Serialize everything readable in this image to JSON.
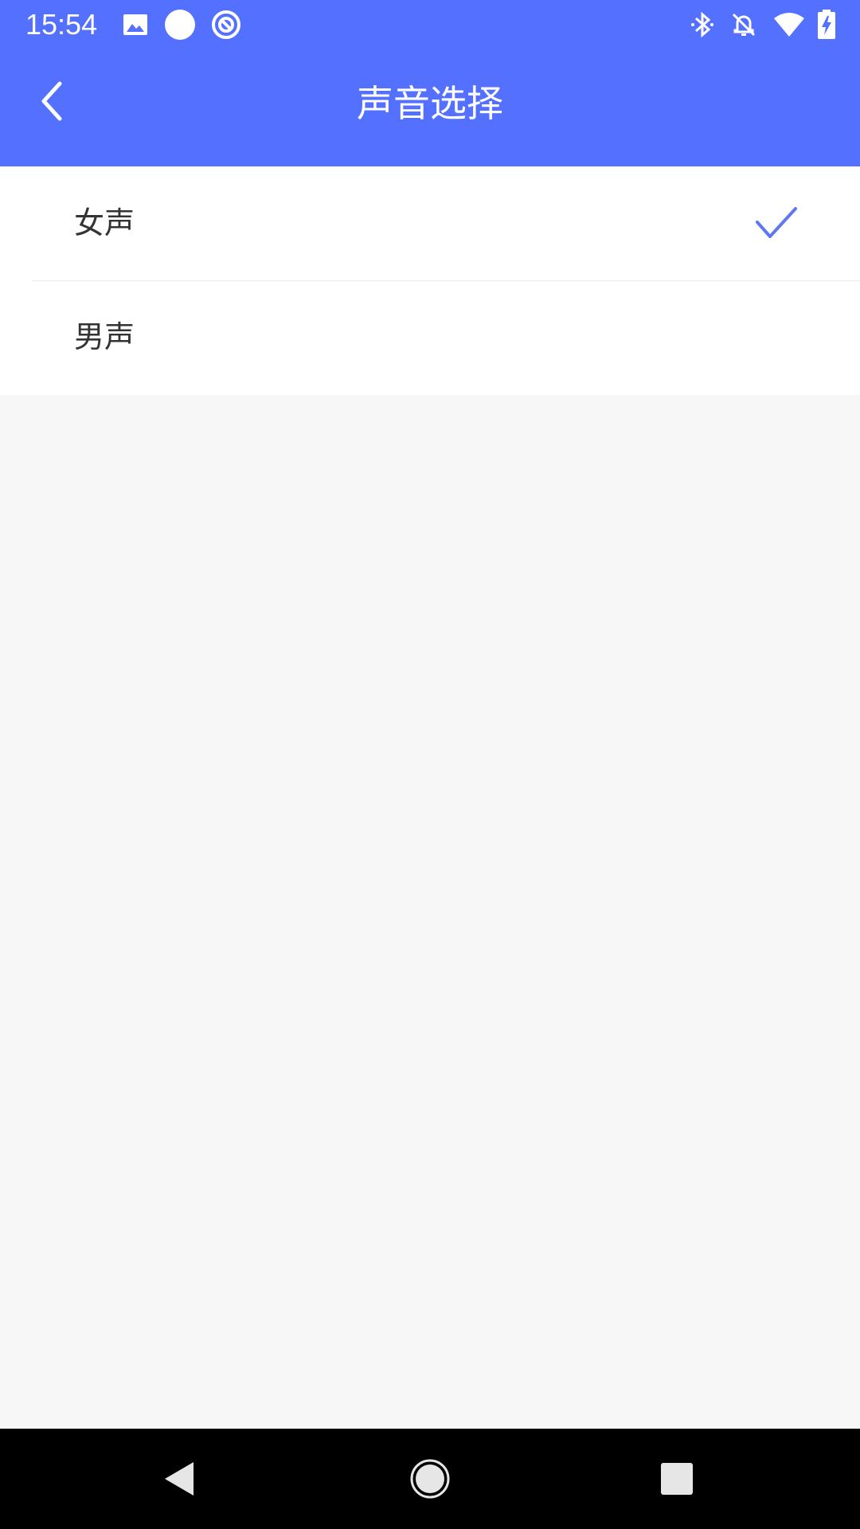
{
  "status_bar": {
    "time": "15:54",
    "battery_level": "71",
    "icons": [
      "image-icon",
      "circle-icon",
      "sync-icon",
      "bluetooth-icon",
      "bell-off-icon",
      "wifi-icon",
      "battery-charging-icon"
    ]
  },
  "app_bar": {
    "title": "声音选择",
    "back_icon": "chevron-left-icon"
  },
  "options": [
    {
      "label": "女声",
      "selected": true
    },
    {
      "label": "男声",
      "selected": false
    }
  ],
  "nav_bar": {
    "icons": [
      "back-triangle-icon",
      "home-circle-icon",
      "recents-square-icon"
    ]
  },
  "colors": {
    "accent": "#5470fe",
    "background": "#f7f7f7",
    "text": "#333333",
    "check": "#5f78f0"
  }
}
